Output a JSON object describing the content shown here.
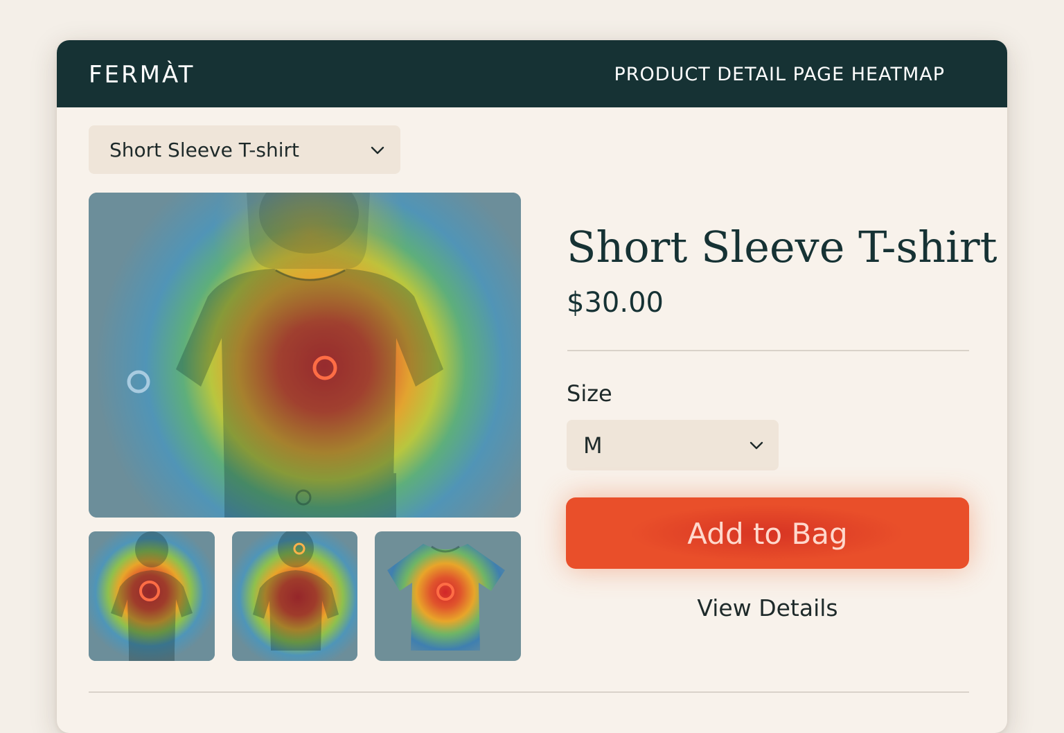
{
  "header": {
    "logo": "FERMÀT",
    "page_label": "PRODUCT DETAIL PAGE HEATMAP"
  },
  "product_selector": {
    "selected": "Short Sleeve T-shirt",
    "icon": "chevron-down-icon"
  },
  "product": {
    "title": "Short Sleeve T-shirt",
    "price": "$30.00"
  },
  "size": {
    "label": "Size",
    "selected": "M",
    "icon": "chevron-down-icon"
  },
  "actions": {
    "add_to_bag": "Add to Bag",
    "view_details": "View Details"
  },
  "colors": {
    "header_bg": "#163234",
    "accent": "#e94f2a",
    "page_bg": "#f8f2eb",
    "select_bg": "#efe5d9"
  }
}
